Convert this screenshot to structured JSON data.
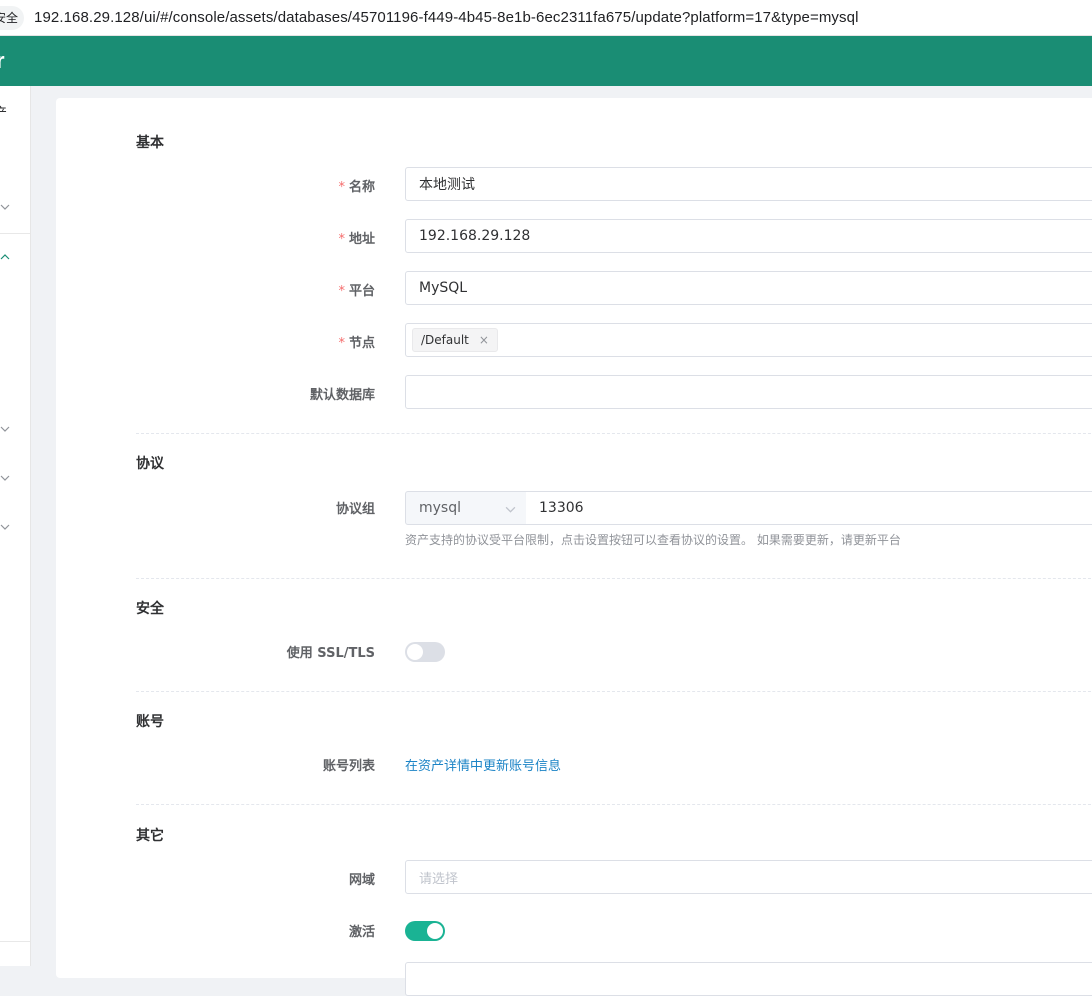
{
  "browser": {
    "security_chip": "安全",
    "url": "192.168.29.128/ui/#/console/assets/databases/45701196-f449-4b45-8e1b-6ec2311fa675/update?platform=17&type=mysql"
  },
  "header": {
    "logo_fragment": "r",
    "bg_color": "#1a8d74"
  },
  "sidebar": {
    "top_fragment": "产"
  },
  "sections": {
    "basic": "基本",
    "protocol": "协议",
    "security": "安全",
    "account": "账号",
    "other": "其它"
  },
  "form": {
    "name": {
      "label": "名称",
      "required": "*",
      "value": "本地测试"
    },
    "address": {
      "label": "地址",
      "required": "*",
      "value": "192.168.29.128"
    },
    "platform": {
      "label": "平台",
      "required": "*",
      "value": "MySQL"
    },
    "nodes": {
      "label": "节点",
      "required": "*",
      "tags": [
        "/Default"
      ],
      "tag_close": "×"
    },
    "default_db": {
      "label": "默认数据库",
      "value": ""
    },
    "protocol_group": {
      "label": "协议组",
      "protocol": "mysql",
      "port": "13306",
      "hint": "资产支持的协议受平台限制，点击设置按钮可以查看协议的设置。 如果需要更新，请更新平台"
    },
    "use_ssl": {
      "label": "使用 SSL/TLS",
      "enabled": false
    },
    "accounts": {
      "label": "账号列表",
      "link": "在资产详情中更新账号信息"
    },
    "domain": {
      "label": "网域",
      "placeholder": "请选择"
    },
    "active": {
      "label": "激活",
      "enabled": true
    }
  },
  "colors": {
    "accent": "#1ab394",
    "link": "#1c84c6",
    "required": "#f56c6c"
  }
}
